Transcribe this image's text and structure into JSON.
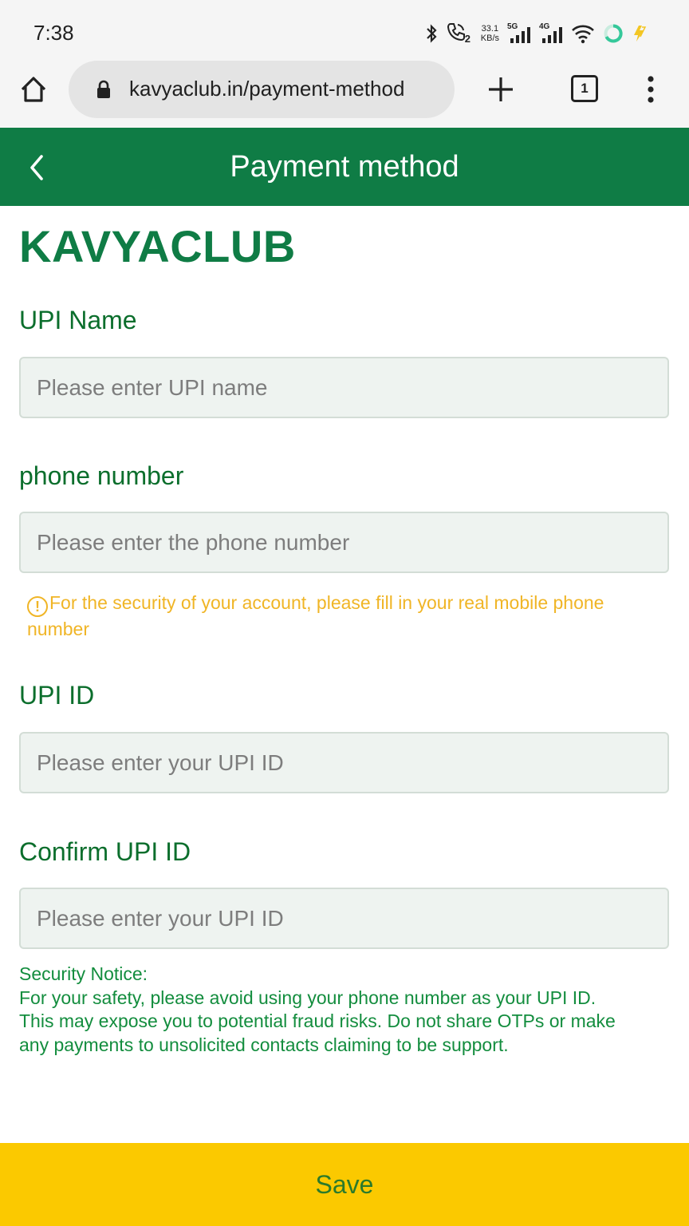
{
  "status_bar": {
    "time": "7:38",
    "speed_value": "33.1",
    "speed_unit": "KB/s",
    "net1": "5G",
    "net2": "4G",
    "sim_index": "2"
  },
  "browser": {
    "url": "kavyaclub.in/payment-method",
    "tab_count": "1"
  },
  "header": {
    "title": "Payment method",
    "color": "#0f7c45"
  },
  "brand": "KAVYACLUB",
  "form": {
    "upi_name": {
      "label": "UPI Name",
      "placeholder": "Please enter UPI name",
      "value": ""
    },
    "phone": {
      "label": "phone number",
      "placeholder": "Please enter the phone number",
      "value": ""
    },
    "phone_warning": "For the security of your account, please fill in your real mobile phone number",
    "upi_id": {
      "label": "UPI ID",
      "placeholder": "Please enter your UPI ID",
      "value": ""
    },
    "confirm_upi_id": {
      "label": "Confirm UPI ID",
      "placeholder": "Please enter your UPI ID",
      "value": ""
    }
  },
  "security_notice": {
    "title": "Security Notice:",
    "body": "For your safety, please avoid using your phone number as your UPI ID. This may expose you to potential fraud risks. Do not share OTPs or make any payments to unsolicited contacts claiming to be support."
  },
  "save_button": {
    "label": "Save",
    "color": "#fbc900"
  },
  "icons": {
    "warning": "!"
  }
}
